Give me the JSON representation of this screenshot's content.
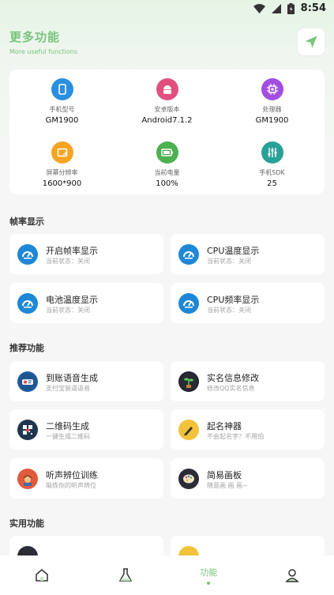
{
  "status_bar": {
    "time": "8:54",
    "icons": [
      "wifi-icon",
      "signal-icon",
      "battery-icon"
    ]
  },
  "header": {
    "title": "更多功能",
    "subtitle": "More useful functions",
    "action_icon": "send-icon"
  },
  "device_info": [
    {
      "label": "手机型号",
      "value": "GM1900",
      "icon": "phone-icon",
      "color": "#2b8fe0"
    },
    {
      "label": "安卓版本",
      "value": "Android7.1.2",
      "icon": "android-icon",
      "color": "#e0507e"
    },
    {
      "label": "处理器",
      "value": "GM1900",
      "icon": "cpu-icon",
      "color": "#a24ee0"
    },
    {
      "label": "屏幕分辨率",
      "value": "1600*900",
      "icon": "screen-icon",
      "color": "#f5a524"
    },
    {
      "label": "当前电量",
      "value": "100%",
      "icon": "battery-icon",
      "color": "#4cb050"
    },
    {
      "label": "手机SDK",
      "value": "25",
      "icon": "sliders-icon",
      "color": "#2aa198"
    }
  ],
  "sections": {
    "frame": "帧率显示",
    "recommend": "推荐功能",
    "practical": "实用功能"
  },
  "frame_items": [
    {
      "title": "开启帧率显示",
      "sub": "当前状态：关闭",
      "icon": "dashboard-icon"
    },
    {
      "title": "CPU温度显示",
      "sub": "当前状态：关闭",
      "icon": "dashboard-icon"
    },
    {
      "title": "电池温度显示",
      "sub": "当前状态：关闭",
      "icon": "dashboard-icon"
    },
    {
      "title": "CPU频率显示",
      "sub": "当前状态：关闭",
      "icon": "dashboard-icon"
    }
  ],
  "recommend_items": [
    {
      "title": "到账语音生成",
      "sub": "支付宝装逼语音",
      "icon": "payment-voice-icon"
    },
    {
      "title": "实名信息修改",
      "sub": "修改QQ实名信息",
      "icon": "plant-icon"
    },
    {
      "title": "二维码生成",
      "sub": "一键生成二维码",
      "icon": "qrcode-icon"
    },
    {
      "title": "起名神器",
      "sub": "不会起名字？不用怕",
      "icon": "pen-icon"
    },
    {
      "title": "听声辨位训练",
      "sub": "锻炼你的听声辨位",
      "icon": "soldier-icon"
    },
    {
      "title": "简易画板",
      "sub": "随意画 画 画~",
      "icon": "palette-icon"
    }
  ],
  "practical_items": [
    {
      "title": "",
      "icon": "practical-icon-1"
    },
    {
      "title": "",
      "icon": "practical-icon-2"
    }
  ],
  "bottom_nav": {
    "items": [
      {
        "label": "",
        "icon": "home-icon"
      },
      {
        "label": "",
        "icon": "flask-icon"
      },
      {
        "label": "功能",
        "icon": "",
        "active": true
      },
      {
        "label": "",
        "icon": "user-icon"
      }
    ]
  }
}
